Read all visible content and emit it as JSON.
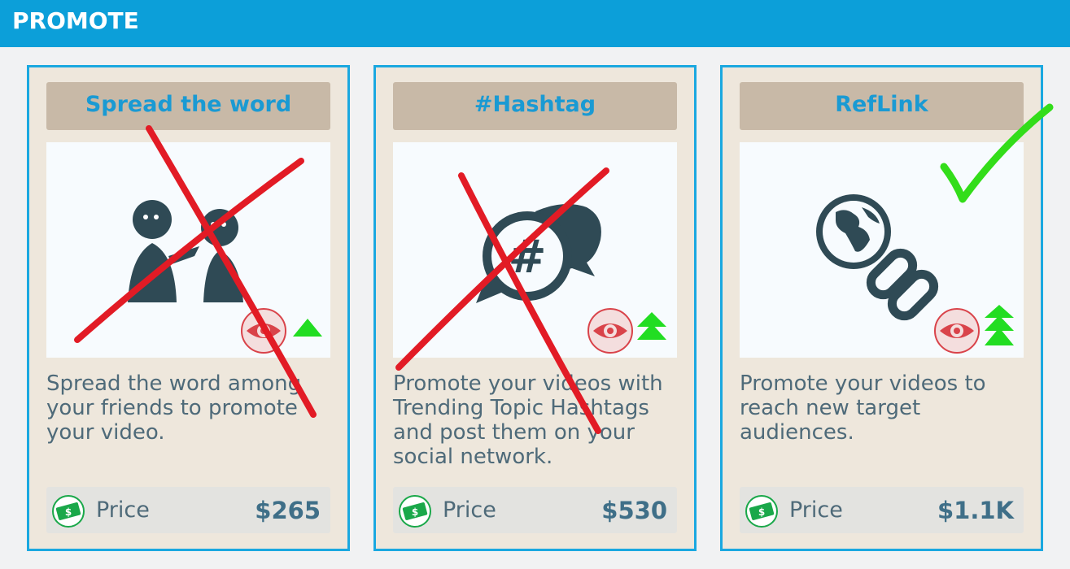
{
  "header": {
    "title": "PROMOTE"
  },
  "cards": [
    {
      "title": "Spread the word",
      "description": "Spread the word among your friends to promote your video.",
      "price_label": "Price",
      "price_value": "$265",
      "icon": "people-talking-icon",
      "visibility_icon": "eye-icon",
      "boost_level": 1,
      "mark": "red-cross"
    },
    {
      "title": "#Hashtag",
      "description": "Promote your videos with Trending Topic Hashtags and post them on your social network.",
      "price_label": "Price",
      "price_value": "$530",
      "icon": "hashtag-speech-icon",
      "visibility_icon": "eye-icon",
      "boost_level": 2,
      "mark": "red-cross"
    },
    {
      "title": "RefLink",
      "description": "Promote your videos to reach new target audiences.",
      "price_label": "Price",
      "price_value": "$1.1K",
      "icon": "globe-link-icon",
      "visibility_icon": "eye-icon",
      "boost_level": 3,
      "mark": "green-checkmark"
    }
  ],
  "colors": {
    "header": "#0c9fd9",
    "card_border": "#1aa8e0",
    "card_bg": "#eee7dc",
    "title_text": "#1a9ad3",
    "icon_dark": "#2f4a55",
    "eye_red": "#d9434a",
    "boost_green": "#22dd22",
    "cross_red": "#e21b25",
    "check_green": "#33dd1a"
  }
}
